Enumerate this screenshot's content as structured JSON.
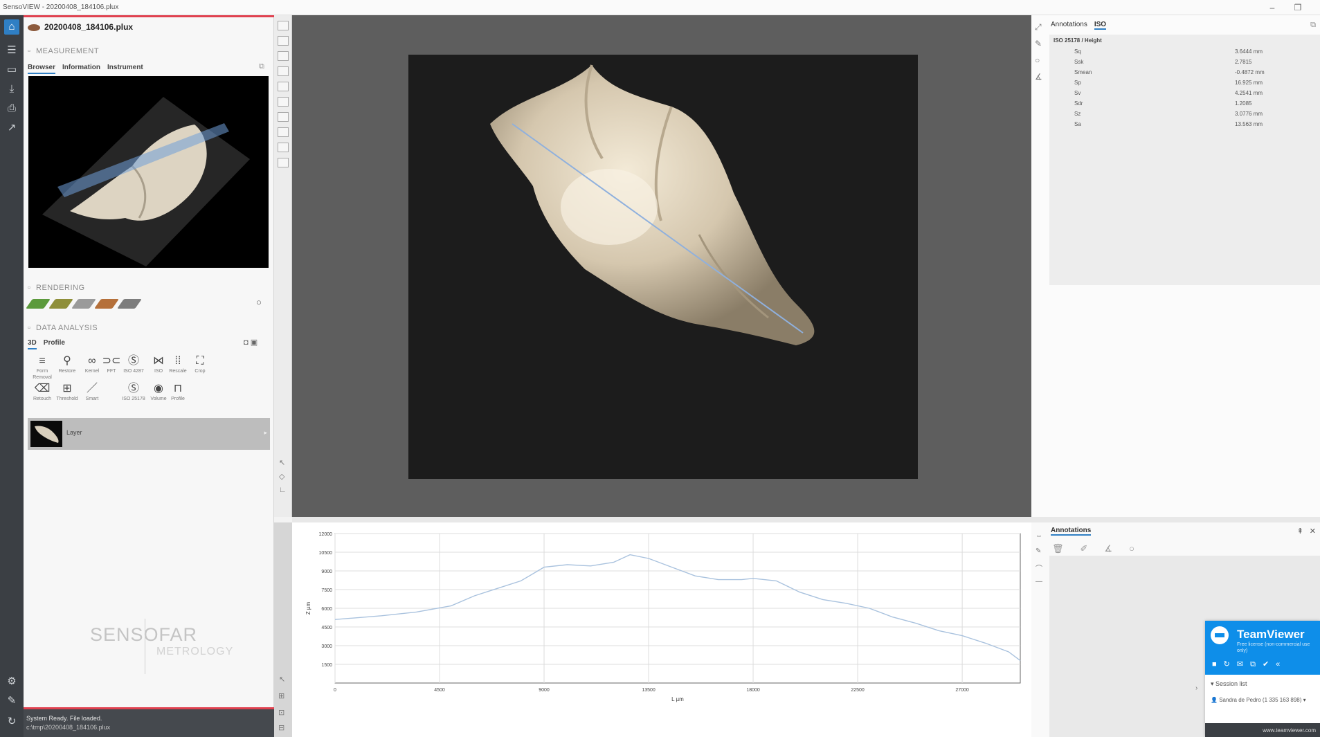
{
  "window": {
    "title": "SensoVIEW - 20200408_184106.plux",
    "controls": [
      "–",
      "❐"
    ]
  },
  "left_rail": {
    "icons": [
      "home-icon",
      "menu-icon",
      "folder-icon",
      "save-icon",
      "export-icon",
      "share-icon",
      "settings-icon",
      "tools-icon",
      "refresh-icon"
    ]
  },
  "left_panel": {
    "file_title": "20200408_184106.plux",
    "measurement": {
      "section": "MEASUREMENT",
      "tabs": [
        "Browser",
        "Information",
        "Instrument"
      ],
      "active_tab": "Browser"
    },
    "rendering": {
      "section": "RENDERING",
      "swatches": [
        "#5c9a3c",
        "#8f8f3a",
        "#9a9a9a",
        "#b5703a",
        "#7d7d7d"
      ]
    },
    "data_analysis": {
      "section": "DATA ANALYSIS",
      "tabs": [
        "3D",
        "Profile"
      ],
      "active_tab": "3D",
      "tools_row1": [
        {
          "icon": "≡",
          "label": "Form Removal"
        },
        {
          "icon": "⚲",
          "label": "Restore"
        },
        {
          "icon": "∞",
          "label": "Kernel"
        },
        {
          "icon": "⊃⊂",
          "label": "FFT"
        },
        {
          "icon": "Ⓢ",
          "label": "ISO 4287"
        },
        {
          "icon": "⋈",
          "label": "ISO"
        },
        {
          "icon": "⁞⁞",
          "label": "Rescale"
        },
        {
          "icon": "⛶",
          "label": "Crop"
        }
      ],
      "tools_row2": [
        {
          "icon": "⌫",
          "label": "Retouch"
        },
        {
          "icon": "⊞",
          "label": "Threshold"
        },
        {
          "icon": "／",
          "label": "Smart"
        },
        {
          "icon": "Ⓢ",
          "label": "ISO 25178"
        },
        {
          "icon": "◉",
          "label": "Volume"
        },
        {
          "icon": "⊓",
          "label": "Profile"
        }
      ]
    },
    "data_item": {
      "name": "Layer"
    },
    "logo": {
      "main": "SENSOFAR",
      "sub": "METROLOGY"
    }
  },
  "status": {
    "line1": "System Ready. File loaded.",
    "line2": "c:\\tmp\\20200408_184106.plux"
  },
  "right_panel": {
    "tabs": [
      "Annotations",
      "ISO"
    ],
    "active_tab": "ISO",
    "table_title": "ISO 25178 / Height",
    "params": [
      {
        "name": "Sq",
        "value": "3.6444 mm"
      },
      {
        "name": "Ssk",
        "value": "2.7815"
      },
      {
        "name": "Smean",
        "value": "-0.4872 mm"
      },
      {
        "name": "Sp",
        "value": "16.925 mm"
      },
      {
        "name": "Sv",
        "value": "4.2541 mm"
      },
      {
        "name": "Sdr",
        "value": "1.2085"
      },
      {
        "name": "Sz",
        "value": "3.0776 mm"
      },
      {
        "name": "Sa",
        "value": "13.563 mm"
      }
    ]
  },
  "annotations_panel": {
    "title": "Annotations",
    "pin": "⇞",
    "close": "✕"
  },
  "teamviewer": {
    "name": "TeamViewer",
    "subtitle": "Free license (non-commercial use only)",
    "session_list": "Session list",
    "session_entry": "Sandra de Pedro (1 335 163 898)",
    "footer": "www.teamviewer.com"
  },
  "chart_data": {
    "type": "line",
    "xlabel": "L µm",
    "ylabel": "Z µm",
    "x_ticks": [
      "0",
      "4500",
      "9000",
      "13500",
      "18000",
      "22500",
      "27000"
    ],
    "y_ticks": [
      "12000",
      "10500",
      "9000",
      "7500",
      "6000",
      "4500",
      "3000",
      "1500"
    ],
    "xlim": [
      0,
      29500
    ],
    "ylim": [
      0,
      12000
    ],
    "grid": true,
    "line_color": "#a9c2de",
    "series": [
      {
        "x": [
          0,
          2000,
          3500,
          5000,
          6000,
          7000,
          8000,
          9000,
          10000,
          11000,
          12000,
          12700,
          13500,
          14500,
          15500,
          16500,
          17500,
          18000,
          19000,
          20000,
          21000,
          22000,
          23000,
          24000,
          25000,
          26000,
          27000,
          28000,
          29000,
          29500
        ],
        "y": [
          5100,
          5400,
          5700,
          6200,
          7000,
          7600,
          8200,
          9300,
          9500,
          9400,
          9700,
          10300,
          10000,
          9300,
          8600,
          8300,
          8300,
          8400,
          8200,
          7300,
          6700,
          6400,
          6000,
          5300,
          4800,
          4200,
          3800,
          3200,
          2500,
          1800
        ]
      }
    ]
  }
}
